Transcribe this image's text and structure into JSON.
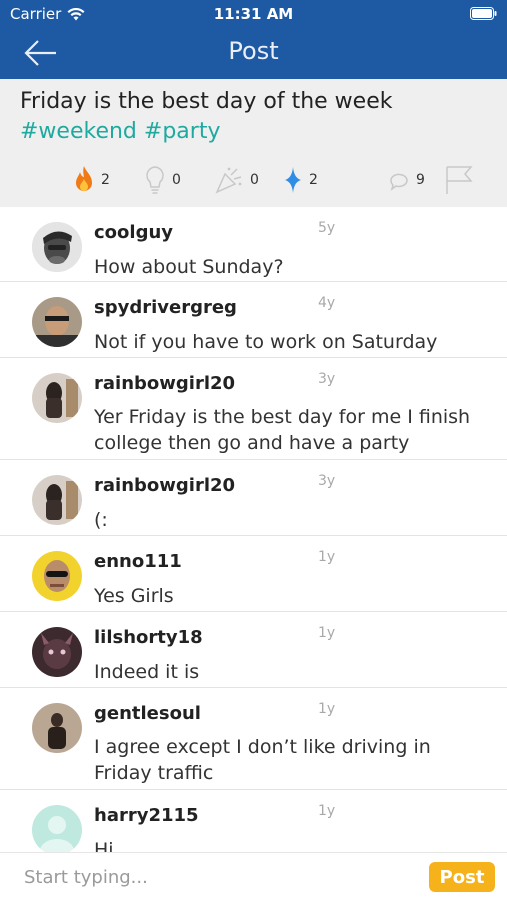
{
  "status_bar": {
    "carrier": "Carrier",
    "time": "11:31 AM"
  },
  "nav": {
    "title": "Post",
    "back_icon": "arrow-left-icon"
  },
  "post": {
    "text": "Friday is the best day of the week",
    "tags": "#weekend #party",
    "reactions": [
      {
        "icon": "fire-icon",
        "count": "2"
      },
      {
        "icon": "lightbulb-icon",
        "count": "0"
      },
      {
        "icon": "party-popper-icon",
        "count": "0"
      },
      {
        "icon": "sparkle-icon",
        "count": "2"
      },
      {
        "icon": "comment-icon",
        "count": "9"
      },
      {
        "icon": "flag-icon",
        "count": ""
      }
    ]
  },
  "comments": [
    {
      "user": "coolguy",
      "age": "5y",
      "text": "How about Sunday?"
    },
    {
      "user": "spydrivergreg",
      "age": "4y",
      "text": "Not if you have to work on Saturday"
    },
    {
      "user": "rainbowgirl20",
      "age": "3y",
      "text": "Yer Friday is the best day for me I finish college then go and have a party"
    },
    {
      "user": "rainbowgirl20",
      "age": "3y",
      "text": "(:"
    },
    {
      "user": "enno111",
      "age": "1y",
      "text": "Yes Girls"
    },
    {
      "user": "lilshorty18",
      "age": "1y",
      "text": "Indeed it is"
    },
    {
      "user": "gentlesoul",
      "age": "1y",
      "text": "I agree except I don’t like driving in Friday traffic"
    },
    {
      "user": "harry2115",
      "age": "1y",
      "text": "Hi"
    }
  ],
  "composer": {
    "placeholder": "Start typing...",
    "post_label": "Post"
  },
  "colors": {
    "header": "#1e5aa3",
    "accent_tag": "#1faaa0",
    "post_button": "#f6b21b",
    "sparkle": "#2f8de6",
    "fire": "#f07a15"
  }
}
